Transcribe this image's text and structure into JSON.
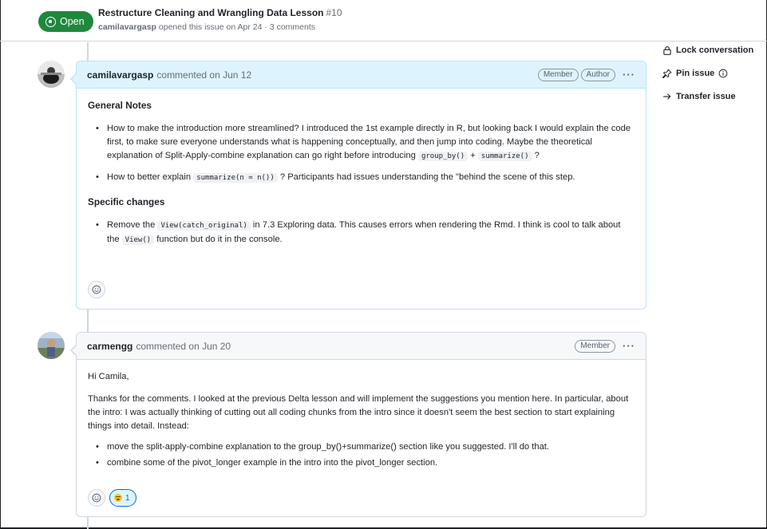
{
  "issue": {
    "state": "Open",
    "title": "Restructure Cleaning and Wrangling Data Lesson",
    "number": "#10",
    "opener": "camilavargasp",
    "meta_text": "opened this issue on Apr 24 · 3 comments"
  },
  "sidebar": {
    "items": [
      {
        "label": "Lock conversation",
        "icon": "lock-icon"
      },
      {
        "label": "Pin issue",
        "icon": "pin-icon"
      },
      {
        "label": "Transfer issue",
        "icon": "arrow-right-icon"
      }
    ]
  },
  "comments": [
    {
      "author": "camilavargasp",
      "action": "commented on Jun 12",
      "badges": [
        "Member",
        "Author"
      ],
      "heading_general": "General Notes",
      "g1_a": "How to make the introduction more streamlined? I introduced the 1st example directly in R, but looking back I would explain the code first, to make sure everyone understands what is happening conceptually, and then jump into coding. Maybe the theoretical explanation of Split-Apply-combine explanation can go right before introducing",
      "g1_code1": "group_by()",
      "g1_b": "+",
      "g1_code2": "summarize()",
      "g1_c": "?",
      "g2_a": "How to better explain",
      "g2_code": "summarize(n = n())",
      "g2_b": "? Participants had issues understanding the \"behind the scene of this step.",
      "heading_specific": "Specific changes",
      "s1_a": "Remove the",
      "s1_code1": "View(catch_original)",
      "s1_b": "in 7.3 Exploring data. This causes errors when rendering the Rmd. I think is cool to talk about the",
      "s1_code2": "View()",
      "s1_c": "function but do it in the console."
    },
    {
      "author": "carmengg",
      "action": "commented on Jun 20",
      "badges": [
        "Member"
      ],
      "greeting": "Hi Camila,",
      "para": "Thanks for the comments. I looked at the previous Delta lesson and will implement the suggestions you mention here. In particular, about the intro: I was actually thinking of cutting out all coding chunks from the intro since it doesn't seem the best section to start explaining things into detail. Instead:",
      "bullets": [
        "move the split-apply-combine explanation to the group_by()+summarize() section like you suggested. I'll do that.",
        "combine some of the pivot_longer example in the intro into the pivot_longer section."
      ],
      "reaction_count": "1"
    }
  ],
  "colors": {
    "open_green": "#1f883d",
    "author_header_bg": "#ddf4ff",
    "author_border": "#b6e3ff",
    "reaction_blue": "#0969da"
  }
}
